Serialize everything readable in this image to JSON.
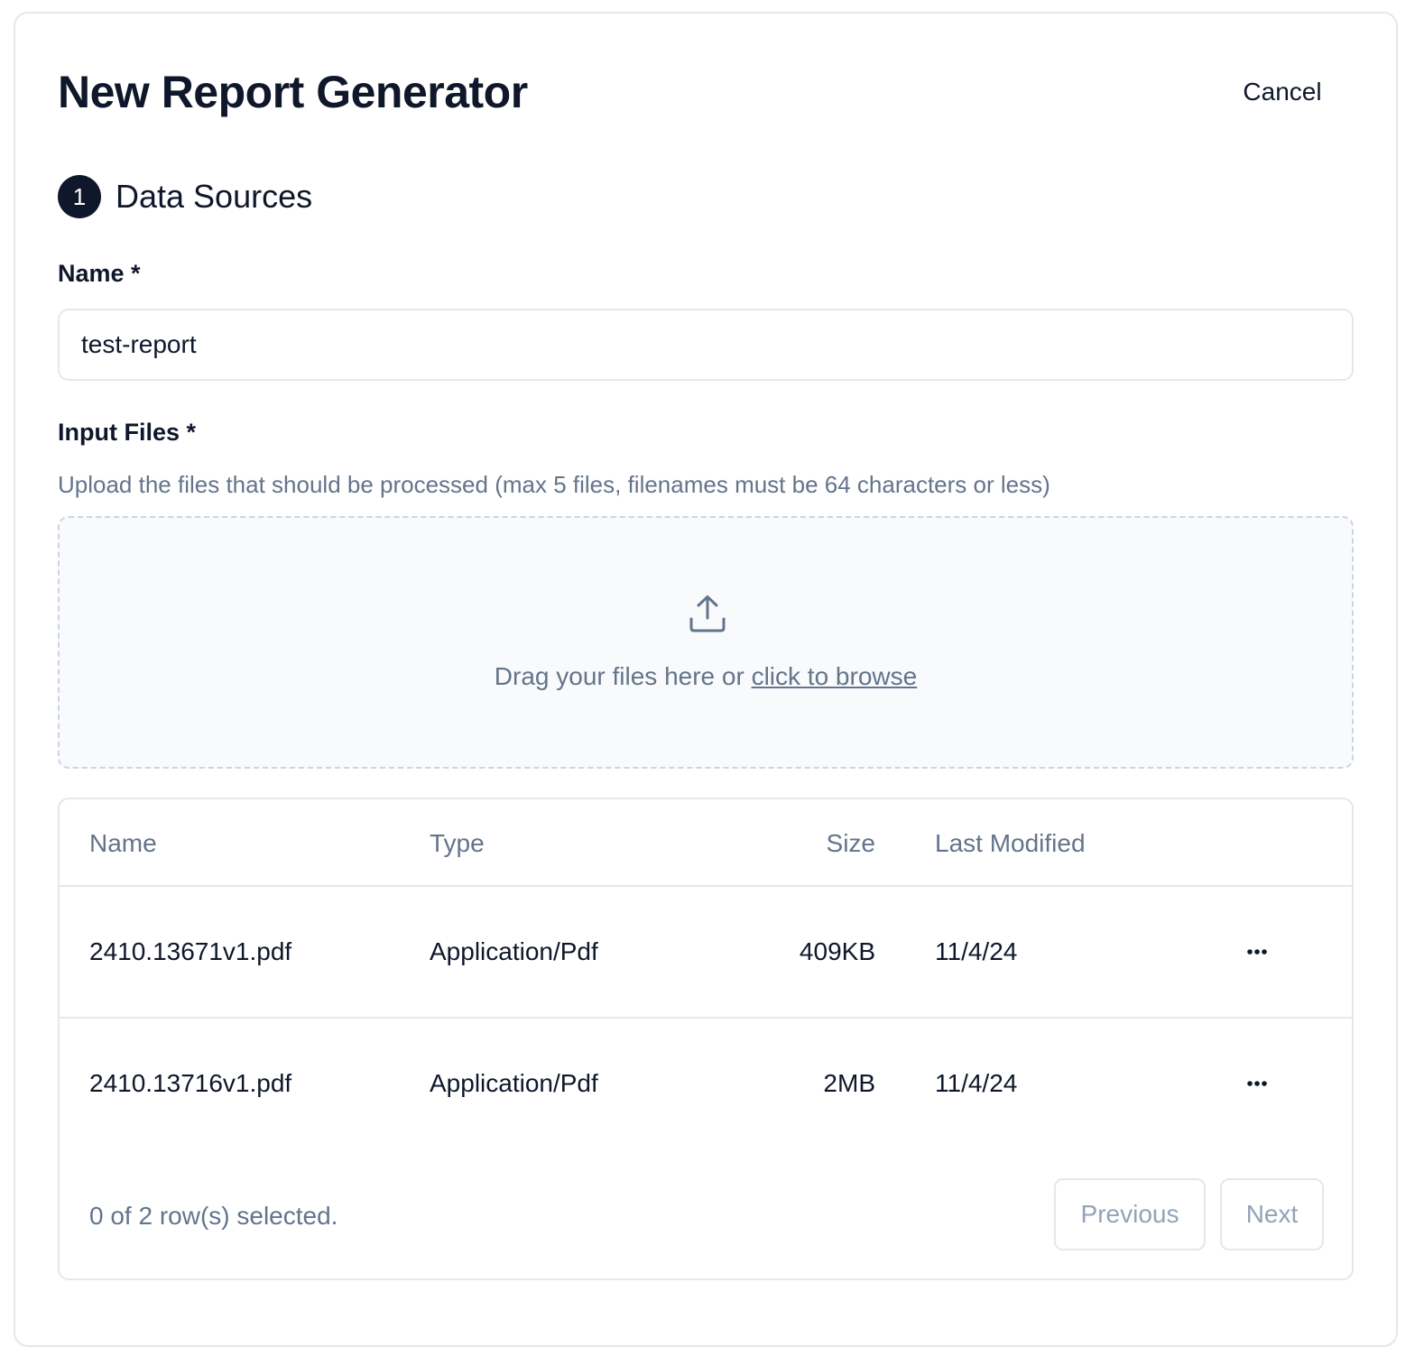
{
  "header": {
    "title": "New Report Generator",
    "cancel_label": "Cancel"
  },
  "step": {
    "number": "1",
    "title": "Data Sources"
  },
  "name_field": {
    "label": "Name *",
    "value": "test-report"
  },
  "files_field": {
    "label": "Input Files *",
    "help": "Upload the files that should be processed (max 5 files, filenames must be 64 characters or less)"
  },
  "dropzone": {
    "text": "Drag your files here or ",
    "link": "click to browse",
    "icon": "upload-icon"
  },
  "table": {
    "columns": [
      "Name",
      "Type",
      "Size",
      "Last Modified"
    ],
    "rows": [
      {
        "name": "2410.13671v1.pdf",
        "type": "Application/Pdf",
        "size": "409KB",
        "modified": "11/4/24"
      },
      {
        "name": "2410.13716v1.pdf",
        "type": "Application/Pdf",
        "size": "2MB",
        "modified": "11/4/24"
      }
    ],
    "selection_status": "0 of 2 row(s) selected.",
    "previous_label": "Previous",
    "next_label": "Next"
  },
  "colors": {
    "primary": "#0f172a",
    "muted": "#64748b",
    "border": "#e5e7eb",
    "dropzone_bg": "#f8fafc"
  }
}
